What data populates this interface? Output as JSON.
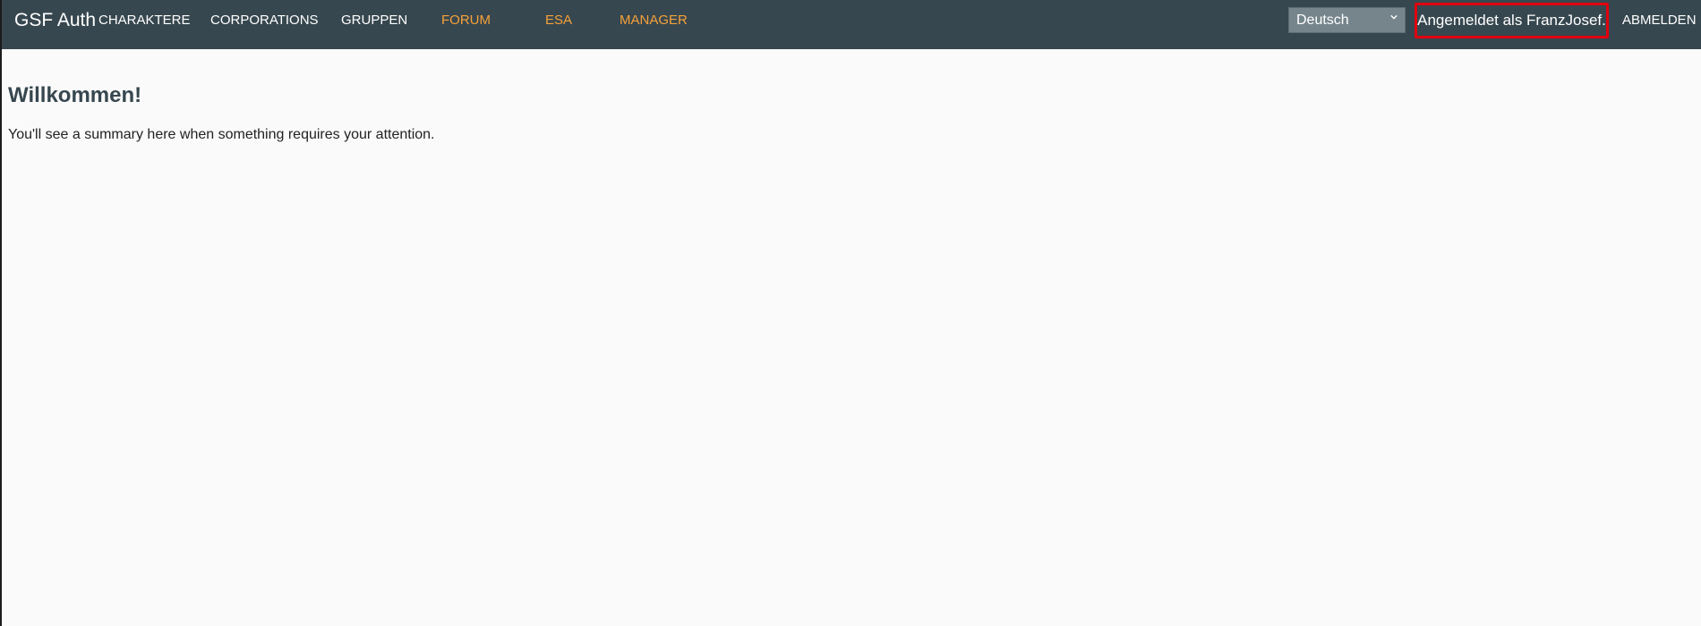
{
  "navbar": {
    "brand": "GSF Auth",
    "links": [
      {
        "label": "CHARAKTERE",
        "accent": false
      },
      {
        "label": "CORPORATIONS",
        "accent": false
      },
      {
        "label": "GRUPPEN",
        "accent": false
      },
      {
        "label": "FORUM",
        "accent": true
      },
      {
        "label": "ESA",
        "accent": true
      },
      {
        "label": "MANAGER",
        "accent": true
      }
    ],
    "language": {
      "selected": "Deutsch",
      "icon": "chevron-down-icon"
    },
    "user_status": "Angemeldet als FranzJosef.",
    "logout_label": "ABMELDEN"
  },
  "main": {
    "heading": "Willkommen!",
    "summary": "You'll see a summary here when something requires your attention."
  },
  "colors": {
    "navbar_bg": "#37474f",
    "accent_link": "#f6a13a",
    "highlight_border": "#e0000f",
    "heading": "#37474f",
    "page_bg": "#fafafa"
  }
}
